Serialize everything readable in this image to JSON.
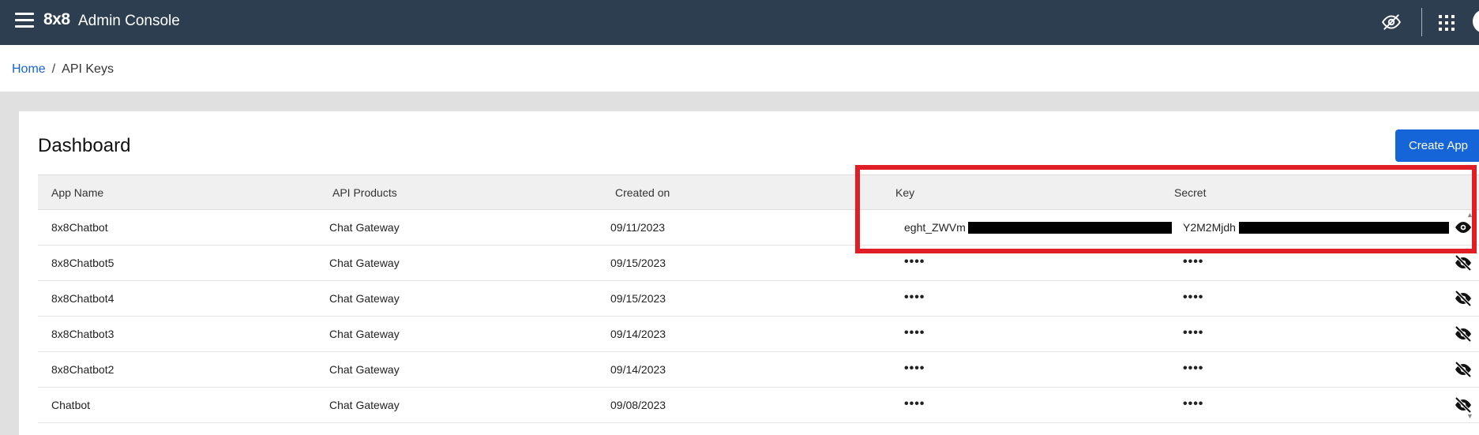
{
  "header": {
    "logo": "8x8",
    "title": "Admin Console",
    "icons": [
      "menu-icon",
      "eye-off-icon",
      "apps-grid-icon",
      "avatar"
    ]
  },
  "breadcrumb": {
    "home": "Home",
    "separator": "/",
    "current": "API Keys"
  },
  "dashboard": {
    "title": "Dashboard",
    "create_label": "Create App"
  },
  "table": {
    "columns": [
      "App Name",
      "API Products",
      "Created on",
      "Key",
      "Secret"
    ],
    "rows": [
      {
        "app": "8x8Chatbot",
        "product": "Chat Gateway",
        "created": "09/11/2023",
        "key": "eght_ZWVm",
        "secret": "Y2M2Mjdh",
        "revealed": true,
        "eye_icon": "eye-icon"
      },
      {
        "app": "8x8Chatbot5",
        "product": "Chat Gateway",
        "created": "09/15/2023",
        "key": "••••",
        "secret": "••••",
        "revealed": false,
        "eye_icon": "eye-off-icon"
      },
      {
        "app": "8x8Chatbot4",
        "product": "Chat Gateway",
        "created": "09/15/2023",
        "key": "••••",
        "secret": "••••",
        "revealed": false,
        "eye_icon": "eye-off-icon"
      },
      {
        "app": "8x8Chatbot3",
        "product": "Chat Gateway",
        "created": "09/14/2023",
        "key": "••••",
        "secret": "••••",
        "revealed": false,
        "eye_icon": "eye-off-icon"
      },
      {
        "app": "8x8Chatbot2",
        "product": "Chat Gateway",
        "created": "09/14/2023",
        "key": "••••",
        "secret": "••••",
        "revealed": false,
        "eye_icon": "eye-off-icon"
      },
      {
        "app": "Chatbot",
        "product": "Chat Gateway",
        "created": "09/08/2023",
        "key": "••••",
        "secret": "••••",
        "revealed": false,
        "eye_icon": "eye-off-icon"
      }
    ]
  },
  "colors": {
    "topbar": "#2c3e50",
    "accent": "#1565d8",
    "highlight": "#e01e26",
    "redaction": "#000000"
  }
}
